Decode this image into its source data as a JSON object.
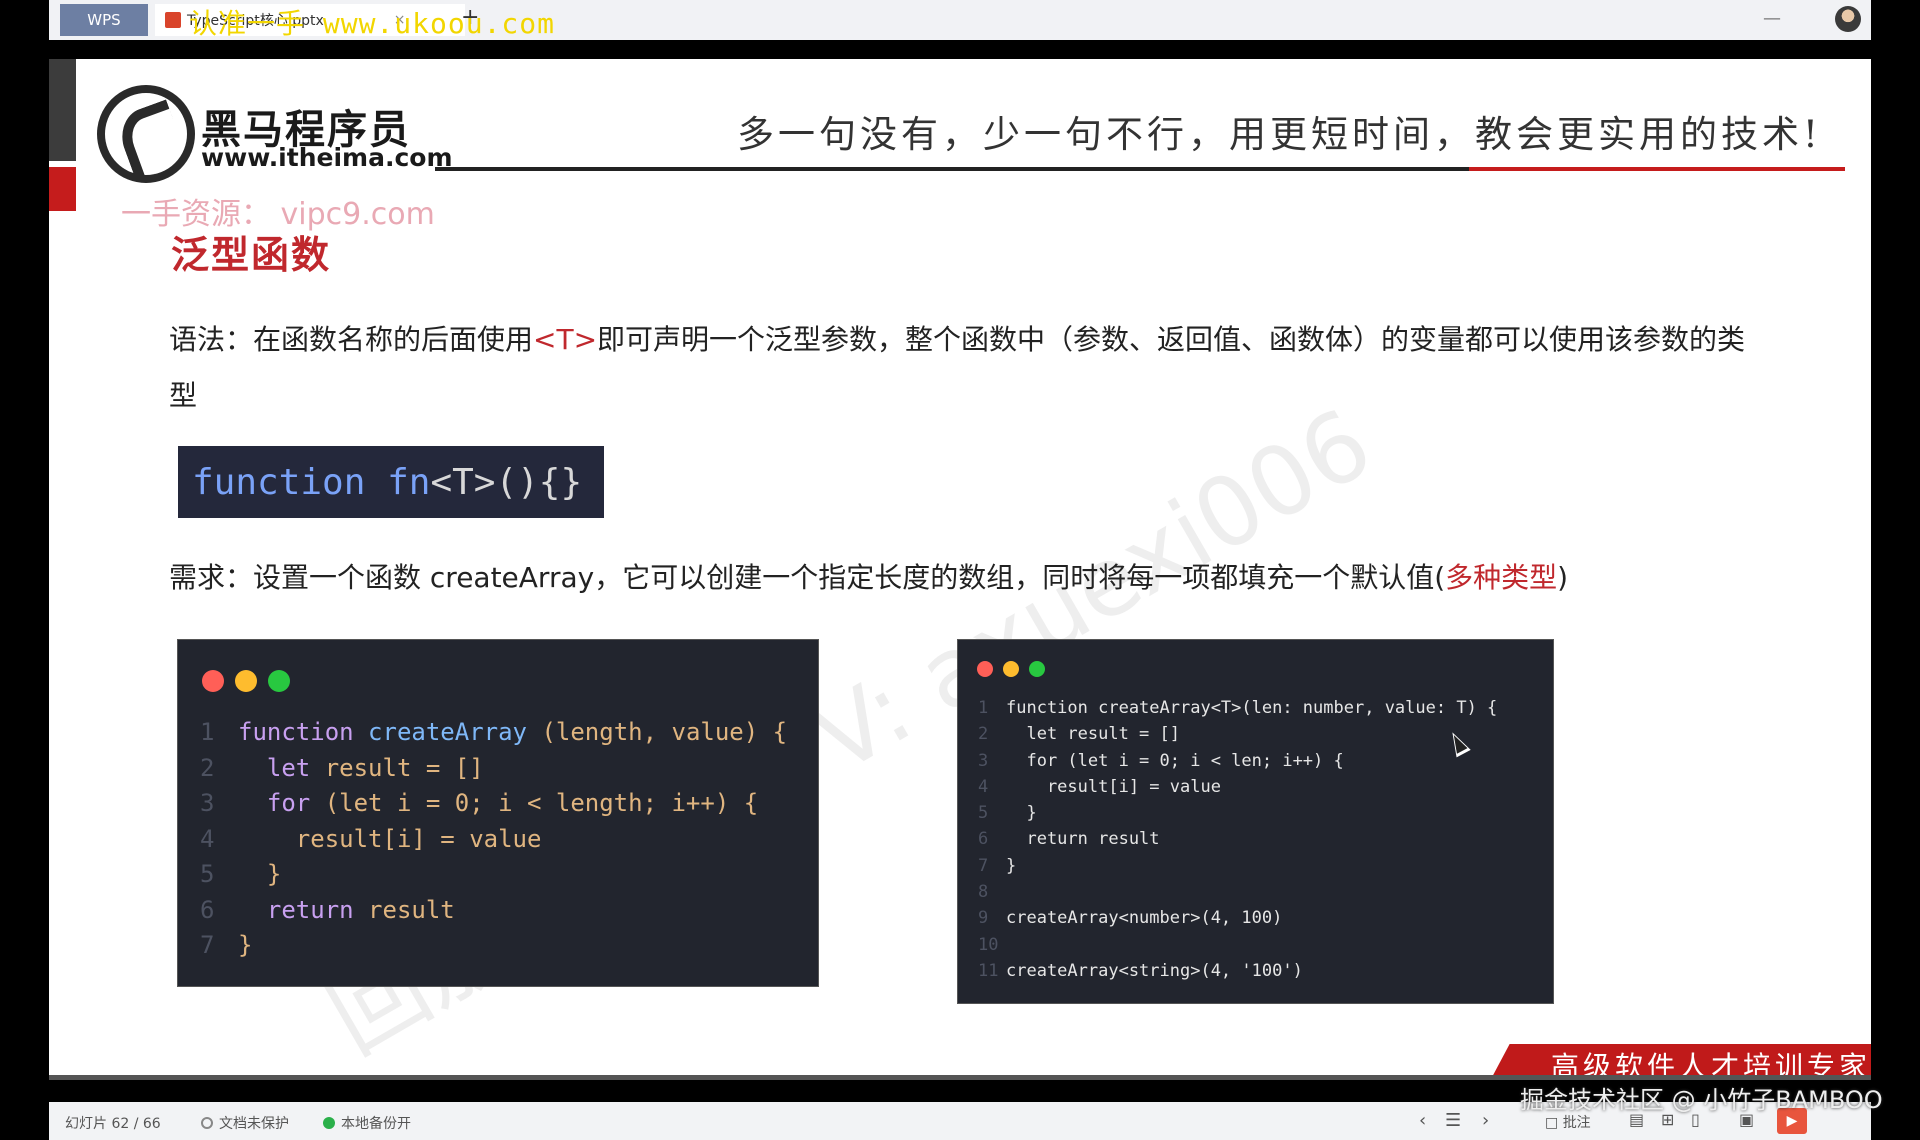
{
  "titlebar": {
    "app_tab": "WPS",
    "doc_tab": "TypeScript核心.pptx",
    "tab_close": "×",
    "new_tab": "+",
    "watermark": "认准一手 www.ukoou.com",
    "minimize": "—"
  },
  "slide": {
    "brand_name": "黑马程序员",
    "brand_url": "www.itheima.com",
    "slogan": "多一句没有，少一句不行，用更短时间，教会更实用的技术!",
    "resource_watermark": "一手资源： vipc9.com",
    "title": "泛型函数",
    "syntax_prefix": "语法：在函数名称的后面使用",
    "syntax_accent": "<T>",
    "syntax_suffix": "即可声明一个泛型参数，整个函数中（参数、返回值、函数体）的变量都可以使用该参数的类型",
    "syntax_code_kw": "function",
    "syntax_code_fn": "fn",
    "syntax_code_rest": "<T>(){}",
    "requirement_prefix": "需求：设置一个函数 createArray，它可以创建一个指定长度的数组，同时将每一项都填充一个默认值(",
    "requirement_accent": "多种类型",
    "requirement_suffix": ")",
    "diag_watermark": "回放正版课+V: axuexi006",
    "footer_slogan": "高级软件人才培训专家",
    "left_code": [
      {
        "n": "1",
        "kw": "function",
        "fn": "createArray",
        "rest": " (length, value) {"
      },
      {
        "n": "2",
        "kw": "  let",
        "fn": "",
        "rest": " result = []"
      },
      {
        "n": "3",
        "kw": "  for",
        "fn": "",
        "rest": " (let i = 0; i < length; i++) {"
      },
      {
        "n": "4",
        "kw": "",
        "fn": "",
        "rest": "    result[i] = value"
      },
      {
        "n": "5",
        "kw": "",
        "fn": "",
        "rest": "  }"
      },
      {
        "n": "6",
        "kw": "  return",
        "fn": "",
        "rest": " result"
      },
      {
        "n": "7",
        "kw": "",
        "fn": "",
        "rest": "}"
      }
    ],
    "right_code": [
      {
        "n": "1",
        "text": "function createArray<T>(len: number, value: T) {"
      },
      {
        "n": "2",
        "text": "  let result = []"
      },
      {
        "n": "3",
        "text": "  for (let i = 0; i < len; i++) {"
      },
      {
        "n": "4",
        "text": "    result[i] = value"
      },
      {
        "n": "5",
        "text": "  }"
      },
      {
        "n": "6",
        "text": "  return result"
      },
      {
        "n": "7",
        "text": "}"
      },
      {
        "n": "8",
        "text": ""
      },
      {
        "n": "9",
        "text": "createArray<number>(4, 100)"
      },
      {
        "n": "10",
        "text": ""
      },
      {
        "n": "11",
        "text": "createArray<string>(4, '100')"
      }
    ]
  },
  "statusbar": {
    "slide_counter": "幻灯片 62 / 66",
    "doc_protect": "文档未保护",
    "local_backup": "本地备份开",
    "comment_label": "批注",
    "prev": "‹",
    "list": "☰",
    "next": "›",
    "play": "▶",
    "juejin_watermark": "掘金技术社区 @ 小竹子BAMBOO"
  },
  "colors": {
    "accent_red": "#c0282d",
    "code_bg": "#22252e",
    "syntax_bg": "#24283b"
  }
}
